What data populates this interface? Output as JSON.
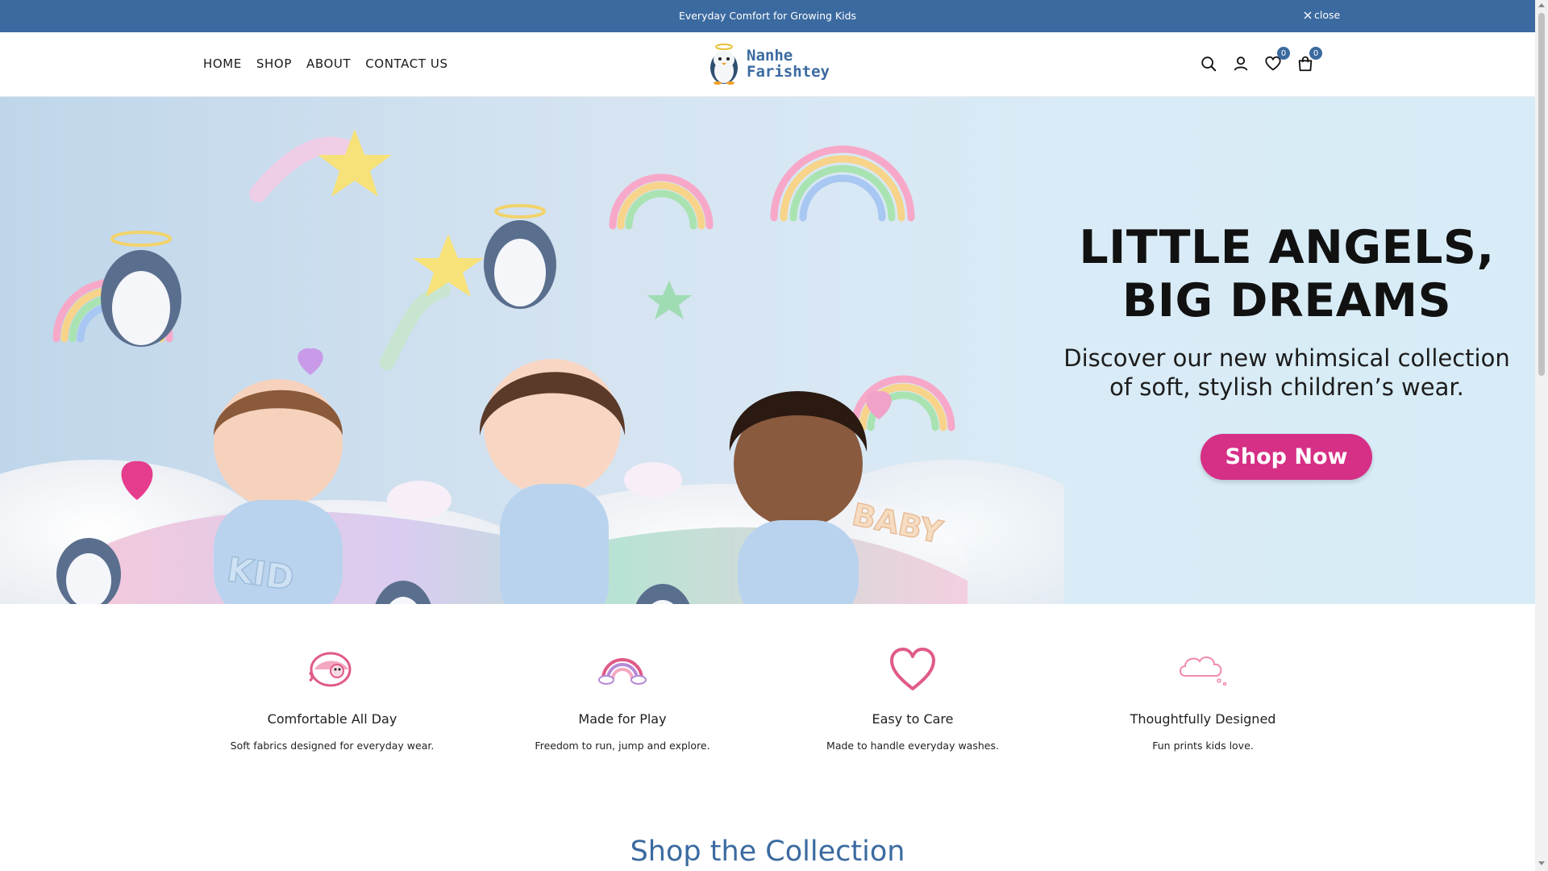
{
  "announcement": {
    "text": "Everyday Comfort for Growing Kids",
    "close_label": "close"
  },
  "header": {
    "nav": [
      {
        "label": "HOME"
      },
      {
        "label": "SHOP"
      },
      {
        "label": "ABOUT"
      },
      {
        "label": "CONTACT US"
      }
    ],
    "logo": {
      "line1": "Nanhe",
      "line2": "Farishtey"
    },
    "wishlist_count": "0",
    "cart_count": "0",
    "icons": [
      "search-icon",
      "account-icon",
      "heart-icon",
      "cart-icon"
    ]
  },
  "hero": {
    "title_line1": "LITTLE ANGELS,",
    "title_line2": "BIG DREAMS",
    "subtitle_line1": "Discover our new whimsical collection",
    "subtitle_line2": "of soft, stylish children’s wear.",
    "cta_label": "Shop Now",
    "scene_text_kid": "KID",
    "scene_text_baby": "BABY"
  },
  "features": [
    {
      "icon": "penguin-icon",
      "title": "Comfortable All Day",
      "desc": "Soft fabrics designed for everyday wear."
    },
    {
      "icon": "rainbow-icon",
      "title": "Made for Play",
      "desc": "Freedom to run, jump and explore."
    },
    {
      "icon": "heart-outline-icon",
      "title": "Easy to Care",
      "desc": "Made to handle everyday washes."
    },
    {
      "icon": "cloud-icon",
      "title": "Thoughtfully Designed",
      "desc": "Fun prints kids love."
    }
  ],
  "section_title": "Shop the Collection",
  "colors": {
    "brand_blue": "#3b6aa0",
    "cta_pink": "#d62f86",
    "feature_pink": "#e05a8a"
  }
}
